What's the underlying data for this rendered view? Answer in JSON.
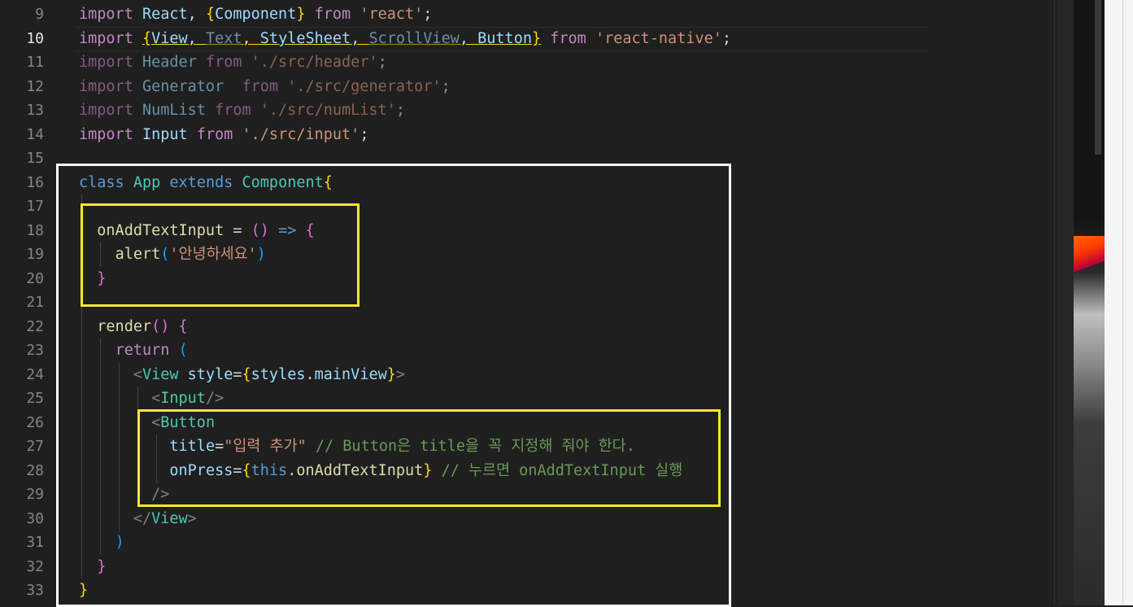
{
  "line_numbers": [
    "9",
    "10",
    "11",
    "12",
    "13",
    "14",
    "15",
    "16",
    "17",
    "18",
    "19",
    "20",
    "21",
    "22",
    "23",
    "24",
    "25",
    "26",
    "27",
    "28",
    "29",
    "30",
    "31",
    "32",
    "33"
  ],
  "tokens": {
    "import_kw": "import",
    "from_kw": "from",
    "react_name": "React",
    "comma": ",",
    "lbrace": "{",
    "rbrace": "}",
    "semicolon": ";",
    "component": "Component",
    "react_module": "'react'",
    "view": "View",
    "text": "Text",
    "stylesheet": "StyleSheet",
    "scrollview": "ScrollView",
    "button": "Button",
    "rn_module": "'react-native'",
    "header_name": "Header",
    "header_path": "'./src/header'",
    "generator_name": "Generator",
    "generator_path": "'./src/generator'",
    "numlist_name": "NumList",
    "numlist_path": "'./src/numList'",
    "input_name": "Input",
    "input_path": "'./src/input'",
    "class_kw": "class",
    "app_name": "App",
    "extends_kw": "extends",
    "on_add_text_input": "onAddTextInput",
    "equals": "=",
    "lparen": "(",
    "rparen": ")",
    "arrow": "=>",
    "alert_fn": "alert",
    "alert_msg": "'안녕하세요'",
    "render_fn": "render",
    "return_kw": "return",
    "tag_open": "<",
    "tag_close": ">",
    "tag_selfclose": "/>",
    "tag_end_open": "</",
    "style_attr": "style",
    "styles_obj": "styles",
    "dot": ".",
    "main_view": "mainView",
    "title_attr": "title",
    "title_value": "\"입력 추가\"",
    "comment_title": "// Button은 title을 꼭 지정해 줘야 한다.",
    "onpress_attr": "onPress",
    "this_kw": "this",
    "comment_onpress": "// 누르면 onAddTextInput 실행"
  }
}
